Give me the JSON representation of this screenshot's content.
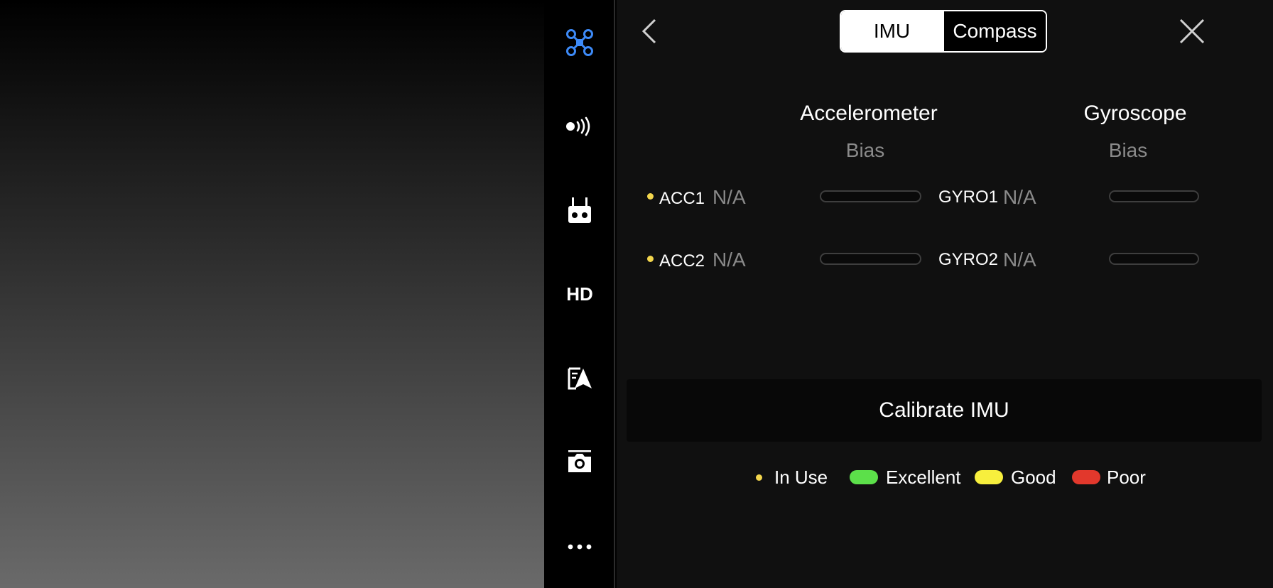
{
  "tabs": {
    "imu": "IMU",
    "compass": "Compass"
  },
  "accelerometer": {
    "title": "Accelerometer",
    "subtitle": "Bias"
  },
  "gyroscope": {
    "title": "Gyroscope",
    "subtitle": "Bias"
  },
  "rows": [
    {
      "acc_label": "ACC1",
      "acc_value": "N/A",
      "gyro_label": "GYRO1",
      "gyro_value": "N/A"
    },
    {
      "acc_label": "ACC2",
      "acc_value": "N/A",
      "gyro_label": "GYRO2",
      "gyro_value": "N/A"
    }
  ],
  "calibrate_label": "Calibrate IMU",
  "legend": {
    "in_use": "In Use",
    "excellent": "Excellent",
    "good": "Good",
    "poor": "Poor"
  },
  "sidebar": {
    "items": [
      "aircraft-icon",
      "signal-icon",
      "remote-controller-icon",
      "hd-label",
      "navigation-icon",
      "camera-icon",
      "more-icon"
    ],
    "hd_label": "HD"
  },
  "colors": {
    "accent": "#3d8af7",
    "in_use": "#f3d64d",
    "excellent": "#5ce04a",
    "good": "#f7ef3d",
    "poor": "#e2382c"
  }
}
